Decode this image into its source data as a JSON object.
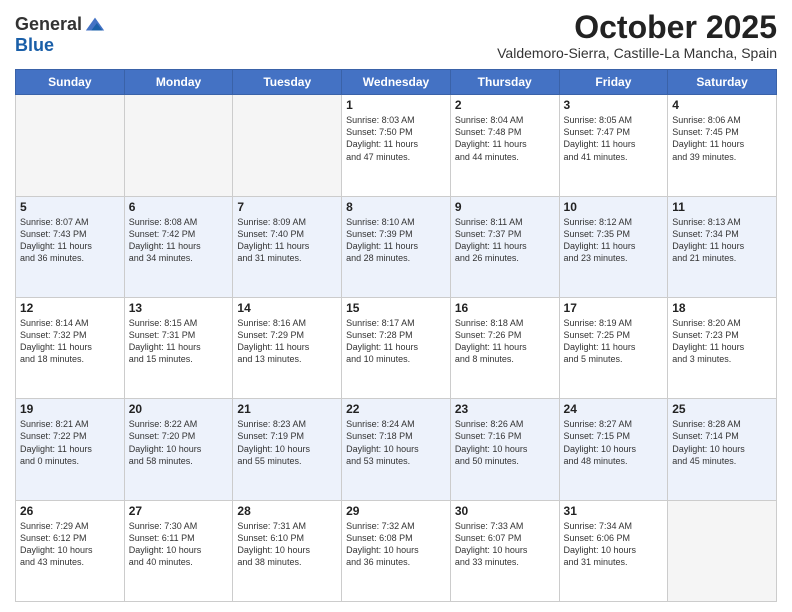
{
  "header": {
    "logo_line1": "General",
    "logo_line2": "Blue",
    "month": "October 2025",
    "location": "Valdemoro-Sierra, Castille-La Mancha, Spain"
  },
  "days_of_week": [
    "Sunday",
    "Monday",
    "Tuesday",
    "Wednesday",
    "Thursday",
    "Friday",
    "Saturday"
  ],
  "weeks": [
    [
      {
        "day": "",
        "text": ""
      },
      {
        "day": "",
        "text": ""
      },
      {
        "day": "",
        "text": ""
      },
      {
        "day": "1",
        "text": "Sunrise: 8:03 AM\nSunset: 7:50 PM\nDaylight: 11 hours\nand 47 minutes."
      },
      {
        "day": "2",
        "text": "Sunrise: 8:04 AM\nSunset: 7:48 PM\nDaylight: 11 hours\nand 44 minutes."
      },
      {
        "day": "3",
        "text": "Sunrise: 8:05 AM\nSunset: 7:47 PM\nDaylight: 11 hours\nand 41 minutes."
      },
      {
        "day": "4",
        "text": "Sunrise: 8:06 AM\nSunset: 7:45 PM\nDaylight: 11 hours\nand 39 minutes."
      }
    ],
    [
      {
        "day": "5",
        "text": "Sunrise: 8:07 AM\nSunset: 7:43 PM\nDaylight: 11 hours\nand 36 minutes."
      },
      {
        "day": "6",
        "text": "Sunrise: 8:08 AM\nSunset: 7:42 PM\nDaylight: 11 hours\nand 34 minutes."
      },
      {
        "day": "7",
        "text": "Sunrise: 8:09 AM\nSunset: 7:40 PM\nDaylight: 11 hours\nand 31 minutes."
      },
      {
        "day": "8",
        "text": "Sunrise: 8:10 AM\nSunset: 7:39 PM\nDaylight: 11 hours\nand 28 minutes."
      },
      {
        "day": "9",
        "text": "Sunrise: 8:11 AM\nSunset: 7:37 PM\nDaylight: 11 hours\nand 26 minutes."
      },
      {
        "day": "10",
        "text": "Sunrise: 8:12 AM\nSunset: 7:35 PM\nDaylight: 11 hours\nand 23 minutes."
      },
      {
        "day": "11",
        "text": "Sunrise: 8:13 AM\nSunset: 7:34 PM\nDaylight: 11 hours\nand 21 minutes."
      }
    ],
    [
      {
        "day": "12",
        "text": "Sunrise: 8:14 AM\nSunset: 7:32 PM\nDaylight: 11 hours\nand 18 minutes."
      },
      {
        "day": "13",
        "text": "Sunrise: 8:15 AM\nSunset: 7:31 PM\nDaylight: 11 hours\nand 15 minutes."
      },
      {
        "day": "14",
        "text": "Sunrise: 8:16 AM\nSunset: 7:29 PM\nDaylight: 11 hours\nand 13 minutes."
      },
      {
        "day": "15",
        "text": "Sunrise: 8:17 AM\nSunset: 7:28 PM\nDaylight: 11 hours\nand 10 minutes."
      },
      {
        "day": "16",
        "text": "Sunrise: 8:18 AM\nSunset: 7:26 PM\nDaylight: 11 hours\nand 8 minutes."
      },
      {
        "day": "17",
        "text": "Sunrise: 8:19 AM\nSunset: 7:25 PM\nDaylight: 11 hours\nand 5 minutes."
      },
      {
        "day": "18",
        "text": "Sunrise: 8:20 AM\nSunset: 7:23 PM\nDaylight: 11 hours\nand 3 minutes."
      }
    ],
    [
      {
        "day": "19",
        "text": "Sunrise: 8:21 AM\nSunset: 7:22 PM\nDaylight: 11 hours\nand 0 minutes."
      },
      {
        "day": "20",
        "text": "Sunrise: 8:22 AM\nSunset: 7:20 PM\nDaylight: 10 hours\nand 58 minutes."
      },
      {
        "day": "21",
        "text": "Sunrise: 8:23 AM\nSunset: 7:19 PM\nDaylight: 10 hours\nand 55 minutes."
      },
      {
        "day": "22",
        "text": "Sunrise: 8:24 AM\nSunset: 7:18 PM\nDaylight: 10 hours\nand 53 minutes."
      },
      {
        "day": "23",
        "text": "Sunrise: 8:26 AM\nSunset: 7:16 PM\nDaylight: 10 hours\nand 50 minutes."
      },
      {
        "day": "24",
        "text": "Sunrise: 8:27 AM\nSunset: 7:15 PM\nDaylight: 10 hours\nand 48 minutes."
      },
      {
        "day": "25",
        "text": "Sunrise: 8:28 AM\nSunset: 7:14 PM\nDaylight: 10 hours\nand 45 minutes."
      }
    ],
    [
      {
        "day": "26",
        "text": "Sunrise: 7:29 AM\nSunset: 6:12 PM\nDaylight: 10 hours\nand 43 minutes."
      },
      {
        "day": "27",
        "text": "Sunrise: 7:30 AM\nSunset: 6:11 PM\nDaylight: 10 hours\nand 40 minutes."
      },
      {
        "day": "28",
        "text": "Sunrise: 7:31 AM\nSunset: 6:10 PM\nDaylight: 10 hours\nand 38 minutes."
      },
      {
        "day": "29",
        "text": "Sunrise: 7:32 AM\nSunset: 6:08 PM\nDaylight: 10 hours\nand 36 minutes."
      },
      {
        "day": "30",
        "text": "Sunrise: 7:33 AM\nSunset: 6:07 PM\nDaylight: 10 hours\nand 33 minutes."
      },
      {
        "day": "31",
        "text": "Sunrise: 7:34 AM\nSunset: 6:06 PM\nDaylight: 10 hours\nand 31 minutes."
      },
      {
        "day": "",
        "text": ""
      }
    ]
  ]
}
